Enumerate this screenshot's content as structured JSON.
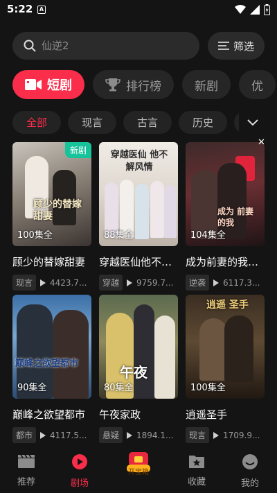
{
  "status": {
    "time": "5:22",
    "notif_badge": "A"
  },
  "search": {
    "placeholder": "仙逆2"
  },
  "filter": {
    "label": "筛选"
  },
  "categories": [
    {
      "label": "短剧",
      "active": true
    },
    {
      "label": "排行榜"
    },
    {
      "label": "新剧"
    },
    {
      "label": "优"
    }
  ],
  "subcategories": [
    {
      "label": "全部",
      "active": true
    },
    {
      "label": "现言"
    },
    {
      "label": "古言"
    },
    {
      "label": "历史"
    }
  ],
  "cards": [
    {
      "title": "顾少的替嫁甜妻",
      "episodes": "100集全",
      "tag": "现言",
      "plays": "4423.7...",
      "badge": "新剧",
      "overlay": "顾少的替嫁甜妻"
    },
    {
      "title": "穿越医仙他不解...",
      "episodes": "88集全",
      "tag": "穿越",
      "plays": "9759.7...",
      "overlay": "穿越医仙 他不解风情"
    },
    {
      "title": "成为前妻的我逆...",
      "episodes": "104集全",
      "tag": "逆袭",
      "plays": "6117.3...",
      "overlay": "成为 前妻的我"
    },
    {
      "title": "巅峰之欲望都市",
      "episodes": "90集全",
      "tag": "都市",
      "plays": "4117.5...",
      "overlay": "巅峰之欲望都市"
    },
    {
      "title": "午夜家政",
      "episodes": "80集全",
      "tag": "悬疑",
      "plays": "1894.1...",
      "overlay": "午夜"
    },
    {
      "title": "逍遥圣手",
      "episodes": "100集全",
      "tag": "现言",
      "plays": "1709.9...",
      "overlay": "逍遥 圣手"
    }
  ],
  "nav": [
    {
      "label": "推荐",
      "icon": "clapperboard-icon"
    },
    {
      "label": "剧场",
      "icon": "play-circle-icon",
      "active": true
    },
    {
      "label": "开宝箱",
      "icon": "treasure-box-icon"
    },
    {
      "label": "收藏",
      "icon": "star-folder-icon"
    },
    {
      "label": "我的",
      "icon": "smiley-icon"
    }
  ],
  "colors": {
    "accent": "#fa2e4a",
    "background": "#141414",
    "new_badge": "#16c39b"
  }
}
